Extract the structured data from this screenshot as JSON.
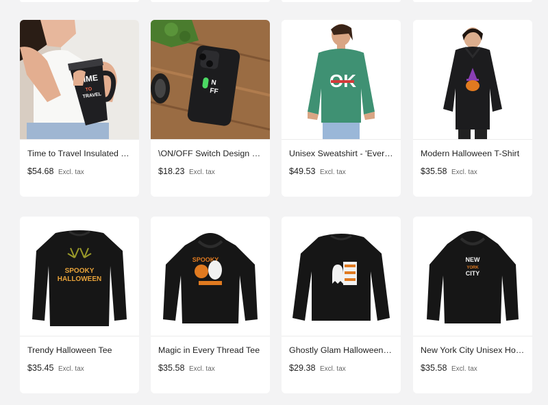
{
  "products": [
    {
      "title": "Time to Travel Insulated Travel Mug",
      "price": "$54.68",
      "tax_note": "Excl. tax",
      "image_icon": "travel-mug-photo"
    },
    {
      "title": "\\ON/OFF Switch Design for Tough Phone Case",
      "price": "$18.23",
      "tax_note": "Excl. tax",
      "image_icon": "phone-case-photo"
    },
    {
      "title": "Unisex Sweatshirt - 'Everything OK'",
      "price": "$49.53",
      "tax_note": "Excl. tax",
      "image_icon": "green-sweatshirt-photo"
    },
    {
      "title": "Modern Halloween T-Shirt",
      "price": "$35.58",
      "tax_note": "Excl. tax",
      "image_icon": "halloween-hoodie-photo"
    },
    {
      "title": "Trendy Halloween Tee",
      "price": "$35.45",
      "tax_note": "Excl. tax",
      "image_icon": "spooky-halloween-longsleeve",
      "print_text": [
        "SPOOKY",
        "HALLOWEEN"
      ]
    },
    {
      "title": "Magic in Every Thread Tee",
      "price": "$35.58",
      "tax_note": "Excl. tax",
      "image_icon": "spooky-ghost-hoodie",
      "print_text": [
        "SPOOKY"
      ]
    },
    {
      "title": "Ghostly Glam Halloween Tee",
      "price": "$29.38",
      "tax_note": "Excl. tax",
      "image_icon": "ghost-sweatshirt"
    },
    {
      "title": "New York City Unisex Hoodie",
      "price": "$35.58",
      "tax_note": "Excl. tax",
      "image_icon": "nyc-hoodie",
      "print_text": [
        "NEW",
        "YORK",
        "CITY"
      ]
    }
  ],
  "mug_print": [
    "TIME",
    "TO",
    "TRAVEL"
  ],
  "phone_print": [
    "N",
    "FF"
  ],
  "sweatshirt_print": [
    "OK"
  ],
  "colors": {
    "background": "#f3f3f4",
    "card": "#ffffff",
    "garment": "#161616",
    "orange": "#e0781e"
  }
}
